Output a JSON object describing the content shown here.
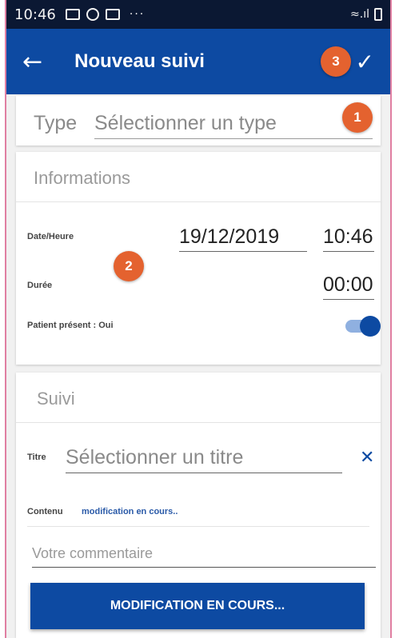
{
  "status_bar": {
    "time": "10:46",
    "overflow": "···",
    "signal_text": "≈.ıl"
  },
  "app_bar": {
    "back_icon": "arrow-left-icon",
    "title": "Nouveau suivi",
    "confirm_icon": "check-icon"
  },
  "badges": [
    "1",
    "2",
    "3"
  ],
  "type_field": {
    "label": "Type",
    "placeholder": "Sélectionner un type"
  },
  "informations": {
    "header": "Informations",
    "date_label": "Date/Heure",
    "date": "19/12/2019",
    "time": "10:46",
    "duration_label": "Durée",
    "duration": "00:00",
    "patient_label": "Patient présent : Oui",
    "patient_present": true
  },
  "suivi": {
    "header": "Suivi",
    "title_label": "Titre",
    "title_placeholder": "Sélectionner un titre",
    "content_label": "Contenu",
    "content_value": "modification en cours..",
    "comment_placeholder": "Votre commentaire",
    "button_label": "MODIFICATION EN COURS..."
  },
  "colors": {
    "primary": "#0d4aa2",
    "badge": "#e4622f",
    "status_bar": "#0b1833"
  }
}
